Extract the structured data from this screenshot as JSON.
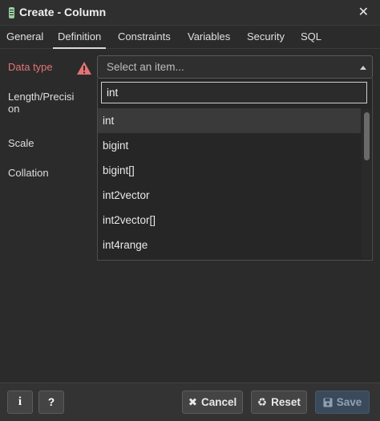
{
  "dialog": {
    "title": "Create - Column",
    "close_icon": "close-icon"
  },
  "tabs": [
    {
      "label": "General"
    },
    {
      "label": "Definition",
      "active": true
    },
    {
      "label": "Constraints"
    },
    {
      "label": "Variables"
    },
    {
      "label": "Security"
    },
    {
      "label": "SQL"
    }
  ],
  "fields": {
    "data_type": {
      "label": "Data type",
      "placeholder": "Select an item...",
      "status": "error"
    },
    "length_precision": {
      "label_line1": "Length/Precisi",
      "label_line2": "on"
    },
    "scale": {
      "label": "Scale"
    },
    "collation": {
      "label": "Collation"
    }
  },
  "dropdown": {
    "search_value": "int",
    "options": [
      "int",
      "bigint",
      "bigint[]",
      "int2vector",
      "int2vector[]",
      "int4range"
    ],
    "highlighted_index": 0
  },
  "footer": {
    "info_label": "i",
    "help_label": "?",
    "cancel_label": "Cancel",
    "reset_label": "Reset",
    "save_label": "Save"
  },
  "colors": {
    "error": "#e57373",
    "warning": "#e57373",
    "save_disabled": "#3b4a5a"
  }
}
